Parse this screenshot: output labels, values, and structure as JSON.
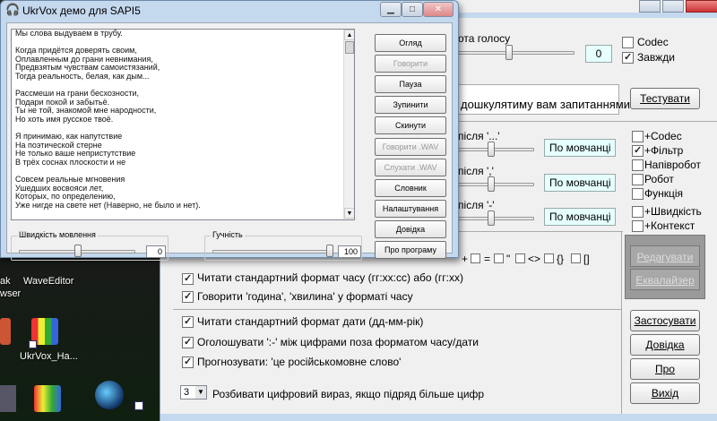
{
  "desktop": {
    "labels": [
      {
        "text": "ak"
      },
      {
        "text": "wser"
      },
      {
        "text": "WaveEditor"
      },
      {
        "text": "UkrVox_Ha..."
      }
    ],
    "icons": [
      "folder-icon",
      "ukrvox-icon",
      "google-earth-icon",
      "shortcut-icon"
    ]
  },
  "back": {
    "volume_label": "ота голосу",
    "volume_value": "0",
    "codec": "Codec",
    "always": "Завжди",
    "question_text": "дошкулятиму вам запитаннями?",
    "test_button": "Тестувати",
    "pause_rows": [
      {
        "label": "після '...'",
        "value": "По мовчанці"
      },
      {
        "label": "після ','",
        "value": "По мовчанці"
      },
      {
        "label": "після '-'",
        "value": "По мовчанці"
      }
    ],
    "right_checks": [
      {
        "label": "+Codec",
        "checked": false
      },
      {
        "label": "+Фільтр",
        "checked": true
      },
      {
        "label": "Напівробот",
        "checked": false
      },
      {
        "label": "Робот",
        "checked": false
      },
      {
        "label": "Функція",
        "checked": false
      }
    ],
    "speed_check": "+Швидкість",
    "contact_check": "+Контекст",
    "symbols": [
      "+",
      "=",
      "\"",
      "<>",
      "{}",
      "[]"
    ],
    "edit_button": "Редагувати",
    "equalizer_button": "Еквалайзер",
    "apply_button": "Застосувати",
    "help_button": "Довідка",
    "about_button": "Про програму",
    "exit_button": "Вихід",
    "options": [
      {
        "label": "Читати стандартний формат часу (гг:хх:сс) або (гг:хх)",
        "checked": true
      },
      {
        "label": "Говорити 'година', 'хвилина' у форматі часу",
        "checked": true
      },
      {
        "label": "Читати стандартний формат дати (дд-мм-рік)",
        "checked": true
      },
      {
        "label": "Оголошувати ':-' між цифрами поза форматом часу/дати",
        "checked": true
      },
      {
        "label": "Прогнозувати: 'це російськомовне слово'",
        "checked": true
      }
    ],
    "digits_value": "3",
    "digits_label": "Розбивати цифровий вираз, якщо підряд більше цифр"
  },
  "front": {
    "title": "UkrVox демо для SAPI5",
    "text_lines": [
      "Мы слова выдуваем в трубу.",
      "",
      "Когда придётся доверять своим,",
      "Оплавленным до грани невнимания,",
      "Предвзятым чувствам самоистязаний,",
      "Тогда реальность, белая, как дым...",
      "",
      "Рассмеши на грани бесхозности,",
      "Подари покой и забытьё.",
      "Ты не той, знакомой мне народности,",
      "Но хоть имя русское твоё.",
      "",
      "Я принимаю, как напутствие",
      "На поэтической стерне",
      "Не только ваше непристутствие",
      "В трёх соснах плоскости и не",
      "",
      "Совсем реальные мгновения",
      "Ушедших восвояси лет,",
      "Которых, по определению,",
      "Уже нигде на свете нет (Наверно, не было и нет)."
    ],
    "buttons": [
      {
        "label": "Огляд",
        "enabled": true
      },
      {
        "label": "Говорити",
        "enabled": false
      },
      {
        "label": "Пауза",
        "enabled": true
      },
      {
        "label": "Зупинити",
        "enabled": true
      },
      {
        "label": "Скинути",
        "enabled": true
      },
      {
        "label": "Говорити .WAV",
        "enabled": false
      },
      {
        "label": "Слухати .WAV",
        "enabled": false
      },
      {
        "label": "Словник",
        "enabled": true
      },
      {
        "label": "Налаштування",
        "enabled": true
      },
      {
        "label": "Довідка",
        "enabled": true
      },
      {
        "label": "Про програму",
        "enabled": true
      }
    ],
    "speed_label": "Швидкість мовлення",
    "speed_value": "0",
    "volume_label": "Гучність",
    "volume_value": "100"
  }
}
